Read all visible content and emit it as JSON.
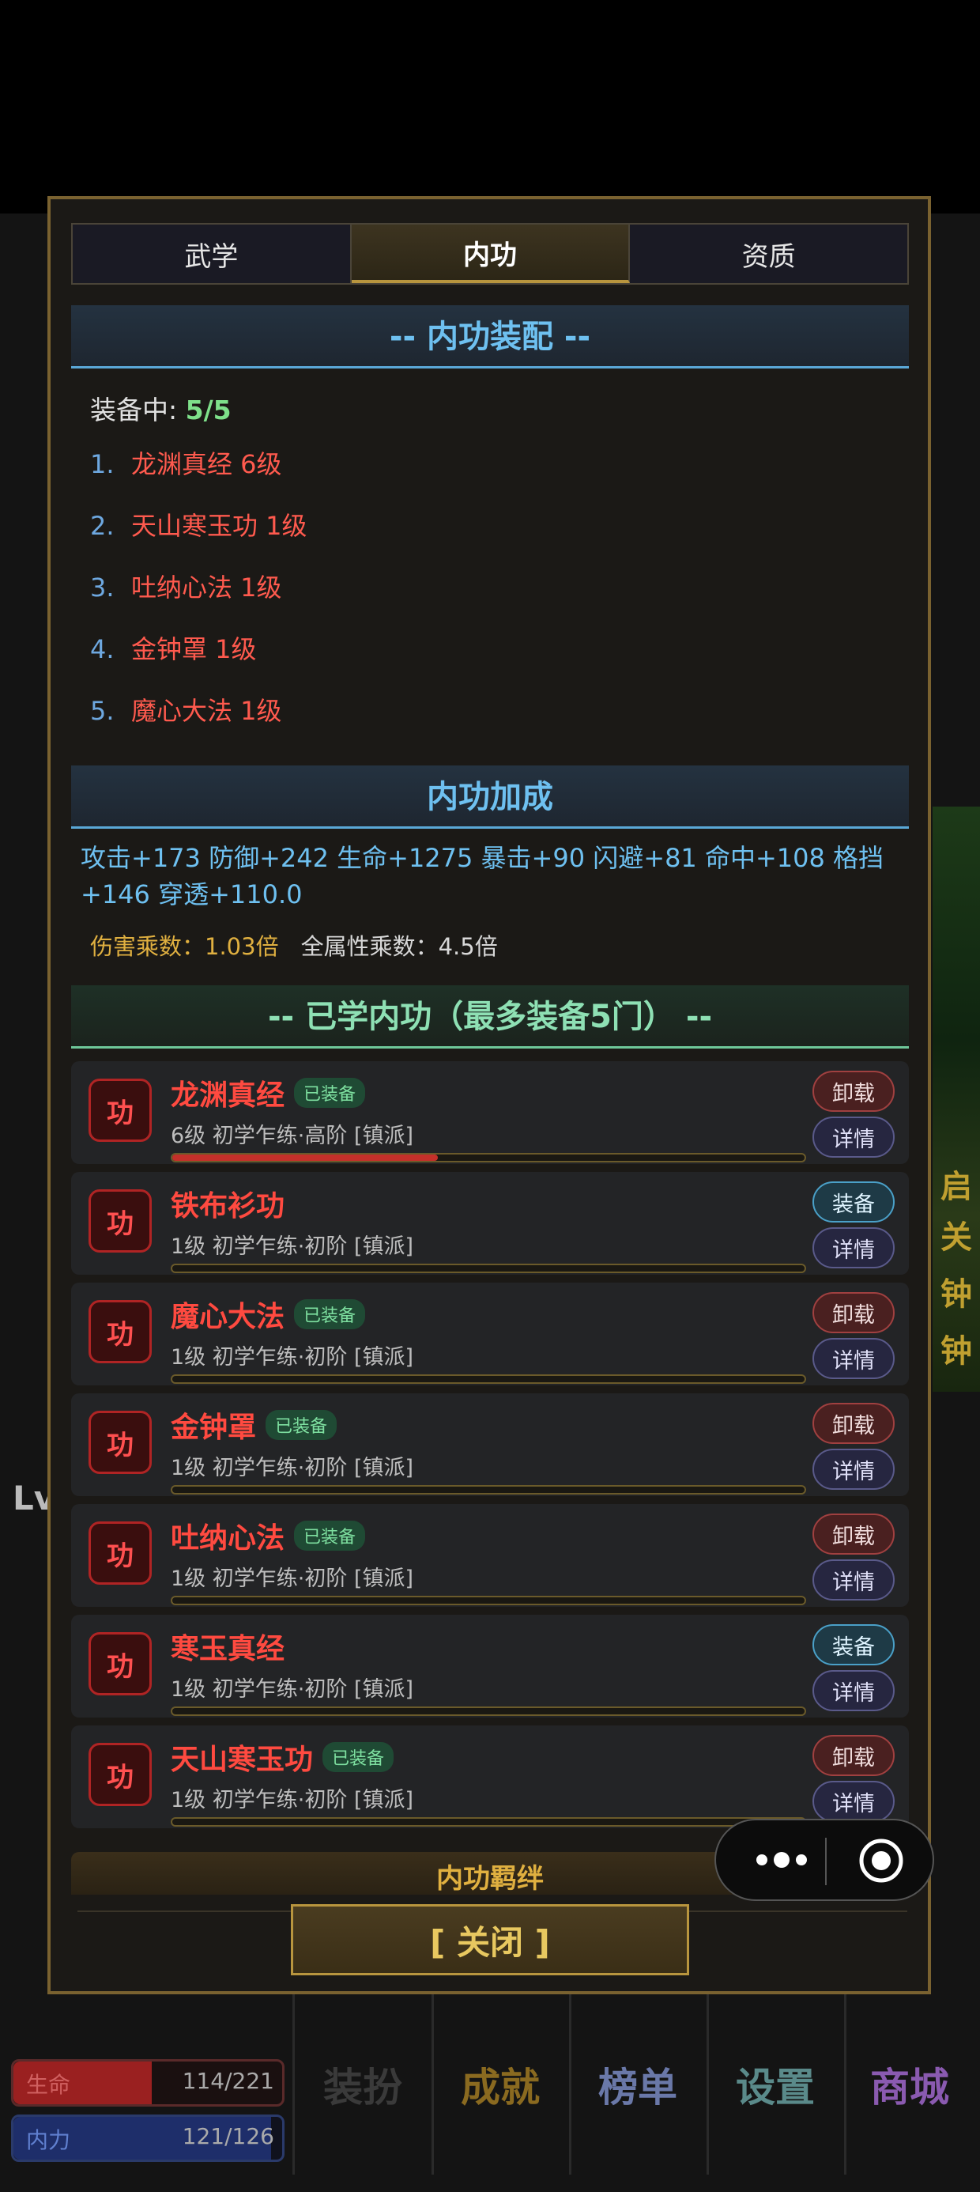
{
  "tabs": [
    "武学",
    "内功",
    "资质"
  ],
  "active_tab": 1,
  "equip_section": {
    "title": "-- 内功装配 --",
    "count_label": "装备中: ",
    "count_value": "5/5",
    "items": [
      {
        "num": "1.",
        "name": "龙渊真经 6级"
      },
      {
        "num": "2.",
        "name": "天山寒玉功 1级"
      },
      {
        "num": "3.",
        "name": "吐纳心法 1级"
      },
      {
        "num": "4.",
        "name": "金钟罩 1级"
      },
      {
        "num": "5.",
        "name": "魔心大法 1级"
      }
    ]
  },
  "bonus_section": {
    "title": "内功加成",
    "stats": "攻击+173  防御+242  生命+1275  暴击+90  闪避+81  命中+108  格挡+146  穿透+110.0",
    "damage_mult": "伤害乘数：1.03倍",
    "attr_mult": "全属性乘数：4.5倍"
  },
  "learned_section": {
    "title": "-- 已学内功（最多装备5门） --",
    "icon_char": "功",
    "equipped_badge": "已装备",
    "btn_unload": "卸载",
    "btn_equip": "装备",
    "btn_detail": "详情",
    "skills": [
      {
        "name": "龙渊真经",
        "equipped": true,
        "meta": "6级  初学乍练·高阶  [镇派]",
        "progress": 0.42
      },
      {
        "name": "铁布衫功",
        "equipped": false,
        "meta": "1级  初学乍练·初阶  [镇派]",
        "progress": 0
      },
      {
        "name": "魔心大法",
        "equipped": true,
        "meta": "1级  初学乍练·初阶  [镇派]",
        "progress": 0
      },
      {
        "name": "金钟罩",
        "equipped": true,
        "meta": "1级  初学乍练·初阶  [镇派]",
        "progress": 0
      },
      {
        "name": "吐纳心法",
        "equipped": true,
        "meta": "1级  初学乍练·初阶  [镇派]",
        "progress": 0
      },
      {
        "name": "寒玉真经",
        "equipped": false,
        "meta": "1级  初学乍练·初阶  [镇派]",
        "progress": 0
      },
      {
        "name": "天山寒玉功",
        "equipped": true,
        "meta": "1级  初学乍练·初阶  [镇派]",
        "progress": 0
      }
    ]
  },
  "next_section_title": "内功羁绊",
  "close_label": "[ 关闭 ]",
  "background": {
    "side_texts": [
      "启",
      "关",
      "钟",
      "钟"
    ],
    "level_label": "Lv",
    "hp_label": "生命",
    "hp_value": "114/221",
    "hp_fraction": 0.516,
    "mp_label": "内力",
    "mp_value": "121/126",
    "mp_fraction": 0.96,
    "bottom_buttons": [
      "装扮",
      "成就",
      "榜单",
      "设置",
      "商城"
    ]
  },
  "colors": {
    "accent_gold": "#b8953e",
    "header_blue": "#6ec0f0",
    "header_green": "#8ee0b4",
    "skill_red": "#ff4a40",
    "count_green": "#7ee08a"
  }
}
